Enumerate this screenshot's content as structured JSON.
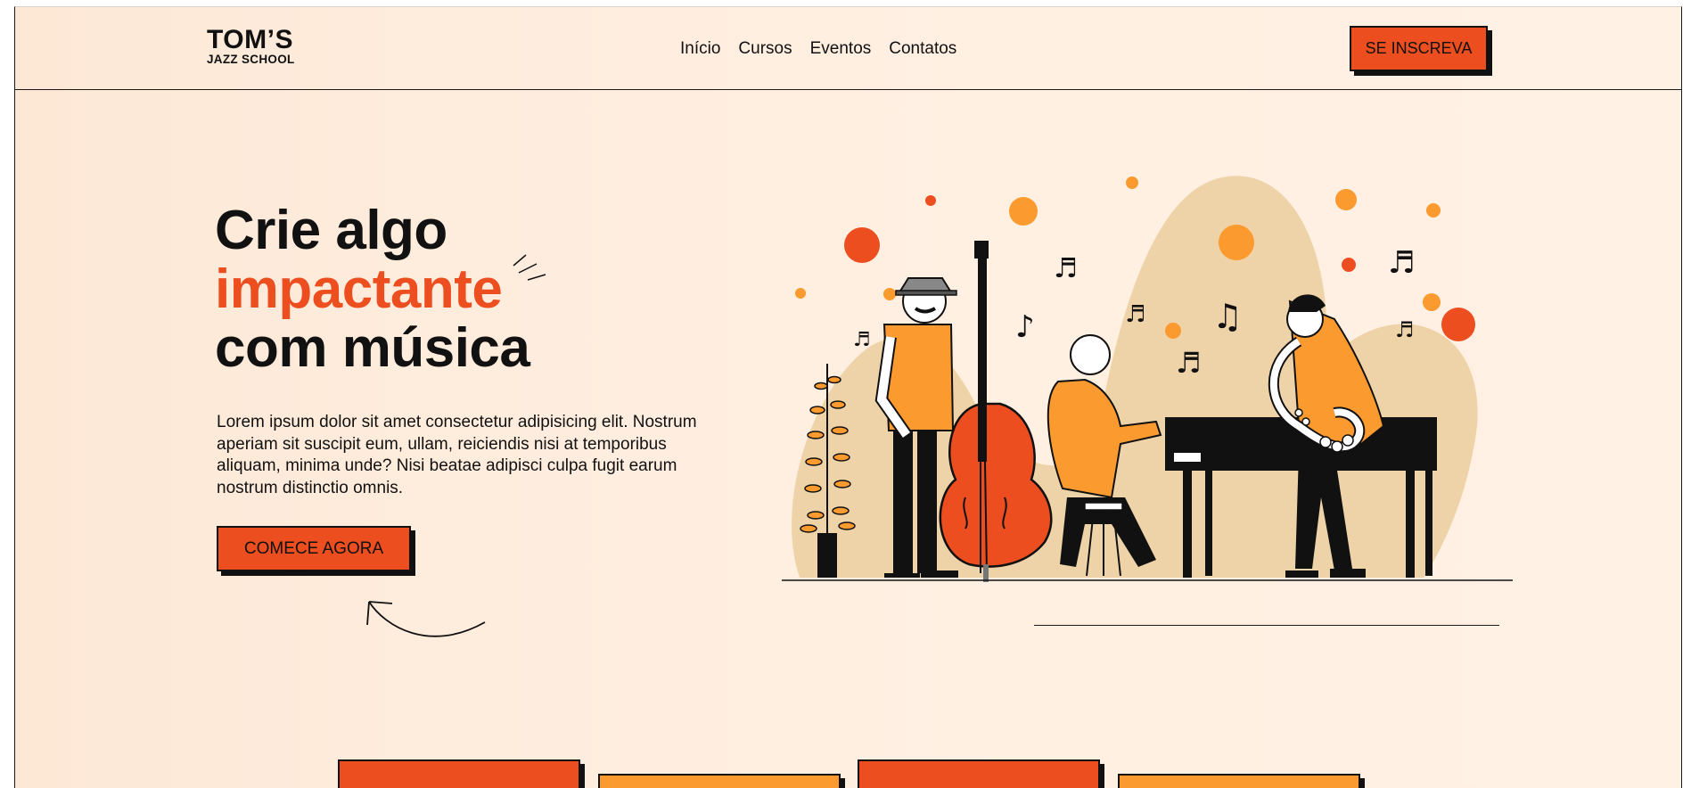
{
  "brand": {
    "name_big": "TOM’S",
    "name_small": "JAZZ SCHOOL"
  },
  "nav": {
    "items": [
      "Início",
      "Cursos",
      "Eventos",
      "Contatos"
    ]
  },
  "header": {
    "cta_label": "SE INSCREVA"
  },
  "hero": {
    "title_line1": "Crie algo",
    "title_accent": "impactante",
    "title_line3": "com música",
    "description": "Lorem ipsum dolor sit amet consectetur adipisicing elit. Nostrum aperiam sit suscipit eum, ullam, reiciendis nisi at temporibus aliquam, minima unde? Nisi beatae adipisci culpa fugit earum nostrum distinctio omnis.",
    "cta_label": "COMECE AGORA"
  },
  "colors": {
    "accent": "#ec4e20",
    "accent_light": "#fb9a2e",
    "background": "#ffefe1",
    "text": "#111111",
    "blob": "#efd3a8"
  },
  "illustration": {
    "name": "jazz-band-illustration",
    "icons": [
      "music-note-icon",
      "plant-icon",
      "double-bass-icon",
      "piano-icon",
      "saxophone-icon"
    ]
  },
  "cards": {
    "colors": [
      "red",
      "orange",
      "red",
      "orange"
    ]
  }
}
